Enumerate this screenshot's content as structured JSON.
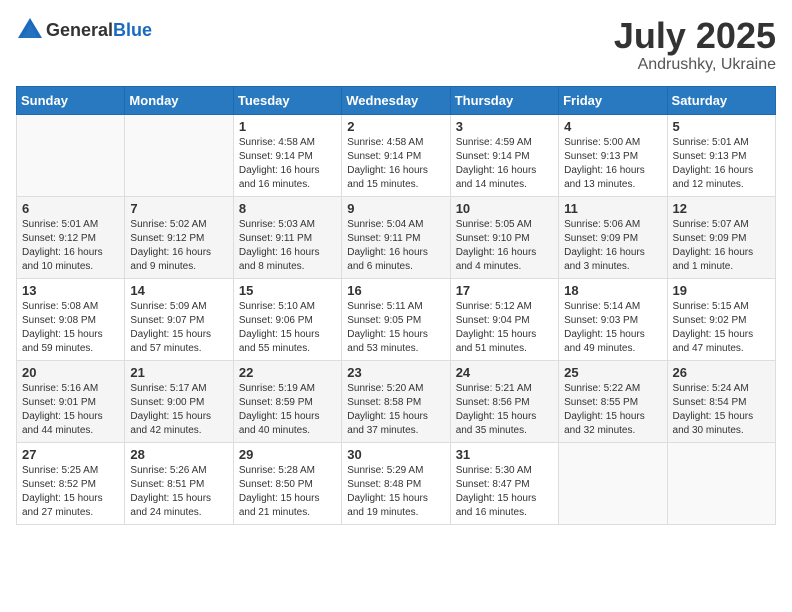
{
  "header": {
    "logo_general": "General",
    "logo_blue": "Blue",
    "month": "July 2025",
    "location": "Andrushky, Ukraine"
  },
  "weekdays": [
    "Sunday",
    "Monday",
    "Tuesday",
    "Wednesday",
    "Thursday",
    "Friday",
    "Saturday"
  ],
  "weeks": [
    [
      {
        "day": "",
        "info": ""
      },
      {
        "day": "",
        "info": ""
      },
      {
        "day": "1",
        "info": "Sunrise: 4:58 AM\nSunset: 9:14 PM\nDaylight: 16 hours and 16 minutes."
      },
      {
        "day": "2",
        "info": "Sunrise: 4:58 AM\nSunset: 9:14 PM\nDaylight: 16 hours and 15 minutes."
      },
      {
        "day": "3",
        "info": "Sunrise: 4:59 AM\nSunset: 9:14 PM\nDaylight: 16 hours and 14 minutes."
      },
      {
        "day": "4",
        "info": "Sunrise: 5:00 AM\nSunset: 9:13 PM\nDaylight: 16 hours and 13 minutes."
      },
      {
        "day": "5",
        "info": "Sunrise: 5:01 AM\nSunset: 9:13 PM\nDaylight: 16 hours and 12 minutes."
      }
    ],
    [
      {
        "day": "6",
        "info": "Sunrise: 5:01 AM\nSunset: 9:12 PM\nDaylight: 16 hours and 10 minutes."
      },
      {
        "day": "7",
        "info": "Sunrise: 5:02 AM\nSunset: 9:12 PM\nDaylight: 16 hours and 9 minutes."
      },
      {
        "day": "8",
        "info": "Sunrise: 5:03 AM\nSunset: 9:11 PM\nDaylight: 16 hours and 8 minutes."
      },
      {
        "day": "9",
        "info": "Sunrise: 5:04 AM\nSunset: 9:11 PM\nDaylight: 16 hours and 6 minutes."
      },
      {
        "day": "10",
        "info": "Sunrise: 5:05 AM\nSunset: 9:10 PM\nDaylight: 16 hours and 4 minutes."
      },
      {
        "day": "11",
        "info": "Sunrise: 5:06 AM\nSunset: 9:09 PM\nDaylight: 16 hours and 3 minutes."
      },
      {
        "day": "12",
        "info": "Sunrise: 5:07 AM\nSunset: 9:09 PM\nDaylight: 16 hours and 1 minute."
      }
    ],
    [
      {
        "day": "13",
        "info": "Sunrise: 5:08 AM\nSunset: 9:08 PM\nDaylight: 15 hours and 59 minutes."
      },
      {
        "day": "14",
        "info": "Sunrise: 5:09 AM\nSunset: 9:07 PM\nDaylight: 15 hours and 57 minutes."
      },
      {
        "day": "15",
        "info": "Sunrise: 5:10 AM\nSunset: 9:06 PM\nDaylight: 15 hours and 55 minutes."
      },
      {
        "day": "16",
        "info": "Sunrise: 5:11 AM\nSunset: 9:05 PM\nDaylight: 15 hours and 53 minutes."
      },
      {
        "day": "17",
        "info": "Sunrise: 5:12 AM\nSunset: 9:04 PM\nDaylight: 15 hours and 51 minutes."
      },
      {
        "day": "18",
        "info": "Sunrise: 5:14 AM\nSunset: 9:03 PM\nDaylight: 15 hours and 49 minutes."
      },
      {
        "day": "19",
        "info": "Sunrise: 5:15 AM\nSunset: 9:02 PM\nDaylight: 15 hours and 47 minutes."
      }
    ],
    [
      {
        "day": "20",
        "info": "Sunrise: 5:16 AM\nSunset: 9:01 PM\nDaylight: 15 hours and 44 minutes."
      },
      {
        "day": "21",
        "info": "Sunrise: 5:17 AM\nSunset: 9:00 PM\nDaylight: 15 hours and 42 minutes."
      },
      {
        "day": "22",
        "info": "Sunrise: 5:19 AM\nSunset: 8:59 PM\nDaylight: 15 hours and 40 minutes."
      },
      {
        "day": "23",
        "info": "Sunrise: 5:20 AM\nSunset: 8:58 PM\nDaylight: 15 hours and 37 minutes."
      },
      {
        "day": "24",
        "info": "Sunrise: 5:21 AM\nSunset: 8:56 PM\nDaylight: 15 hours and 35 minutes."
      },
      {
        "day": "25",
        "info": "Sunrise: 5:22 AM\nSunset: 8:55 PM\nDaylight: 15 hours and 32 minutes."
      },
      {
        "day": "26",
        "info": "Sunrise: 5:24 AM\nSunset: 8:54 PM\nDaylight: 15 hours and 30 minutes."
      }
    ],
    [
      {
        "day": "27",
        "info": "Sunrise: 5:25 AM\nSunset: 8:52 PM\nDaylight: 15 hours and 27 minutes."
      },
      {
        "day": "28",
        "info": "Sunrise: 5:26 AM\nSunset: 8:51 PM\nDaylight: 15 hours and 24 minutes."
      },
      {
        "day": "29",
        "info": "Sunrise: 5:28 AM\nSunset: 8:50 PM\nDaylight: 15 hours and 21 minutes."
      },
      {
        "day": "30",
        "info": "Sunrise: 5:29 AM\nSunset: 8:48 PM\nDaylight: 15 hours and 19 minutes."
      },
      {
        "day": "31",
        "info": "Sunrise: 5:30 AM\nSunset: 8:47 PM\nDaylight: 15 hours and 16 minutes."
      },
      {
        "day": "",
        "info": ""
      },
      {
        "day": "",
        "info": ""
      }
    ]
  ]
}
